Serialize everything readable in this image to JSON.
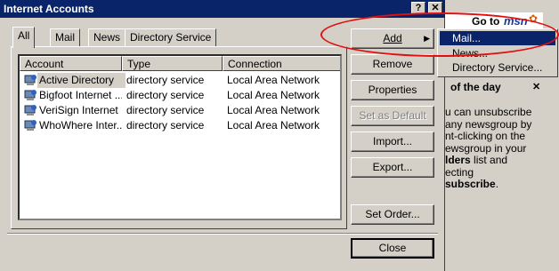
{
  "dialog": {
    "title": "Internet Accounts",
    "help_btn": "?",
    "close_btn": "✕"
  },
  "tabs": [
    {
      "label": "All",
      "active": true
    },
    {
      "label": "Mail"
    },
    {
      "label": "News"
    },
    {
      "label": "Directory Service"
    }
  ],
  "columns": [
    "Account",
    "Type",
    "Connection"
  ],
  "rows": [
    {
      "account": "Active Directory",
      "type": "directory service",
      "connection": "Local Area Network"
    },
    {
      "account": "Bigfoot Internet ...",
      "type": "directory service",
      "connection": "Local Area Network"
    },
    {
      "account": "VeriSign Internet ...",
      "type": "directory service",
      "connection": "Local Area Network"
    },
    {
      "account": "WhoWhere Inter...",
      "type": "directory service",
      "connection": "Local Area Network"
    }
  ],
  "buttons": {
    "add": "Add",
    "remove": "Remove",
    "properties": "Properties",
    "set_default": "Set as Default",
    "import": "Import...",
    "export": "Export...",
    "set_order": "Set Order...",
    "close": "Close"
  },
  "add_menu": {
    "items": [
      "Mail...",
      "News...",
      "Directory Service..."
    ],
    "selected_index": 0
  },
  "background": {
    "go_to": "Go to",
    "msn": "msn",
    "heading": "of the day",
    "close_x": "✕",
    "lines": [
      "u can unsubscribe",
      "any newsgroup by",
      "nt-clicking on the",
      "ewsgroup in your"
    ],
    "bold_line": "lders",
    "bold_line_rest": " list and",
    "line6": "ecting",
    "bold_last": "subscribe",
    "bold_last_rest": "."
  },
  "colors": {
    "titlebar": "#0a246a",
    "highlight_oval": "#e01010",
    "face": "#d4d0c8"
  }
}
